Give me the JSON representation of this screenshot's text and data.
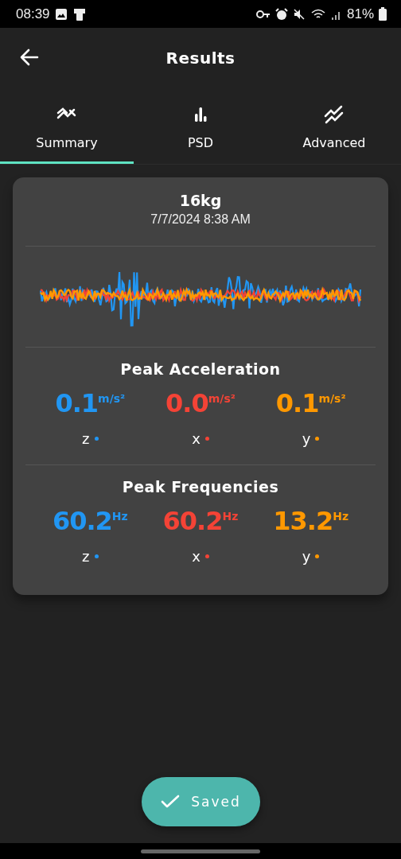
{
  "status_bar": {
    "time": "08:39",
    "battery": "81%"
  },
  "header": {
    "title": "Results"
  },
  "tabs": [
    {
      "label": "Summary",
      "kind": "trend",
      "selected": true
    },
    {
      "label": "PSD",
      "kind": "bars",
      "selected": false
    },
    {
      "label": "Advanced",
      "kind": "zigzag",
      "selected": false
    }
  ],
  "card": {
    "title": "16kg",
    "timestamp": "7/7/2024 8:38 AM",
    "sections": [
      {
        "title": "Peak Acceleration",
        "readings": [
          {
            "value": "0.1",
            "unit": "m/s²",
            "axis": "z",
            "color": "#2196f3"
          },
          {
            "value": "0.0",
            "unit": "m/s²",
            "axis": "x",
            "color": "#f44336"
          },
          {
            "value": "0.1",
            "unit": "m/s²",
            "axis": "y",
            "color": "#ff9800"
          }
        ]
      },
      {
        "title": "Peak Frequencies",
        "readings": [
          {
            "value": "60.2",
            "unit": "Hz",
            "axis": "z",
            "color": "#2196f3"
          },
          {
            "value": "60.2",
            "unit": "Hz",
            "axis": "x",
            "color": "#f44336"
          },
          {
            "value": "13.2",
            "unit": "Hz",
            "axis": "y",
            "color": "#ff9800"
          }
        ]
      }
    ]
  },
  "save_button": {
    "label": "Saved"
  }
}
